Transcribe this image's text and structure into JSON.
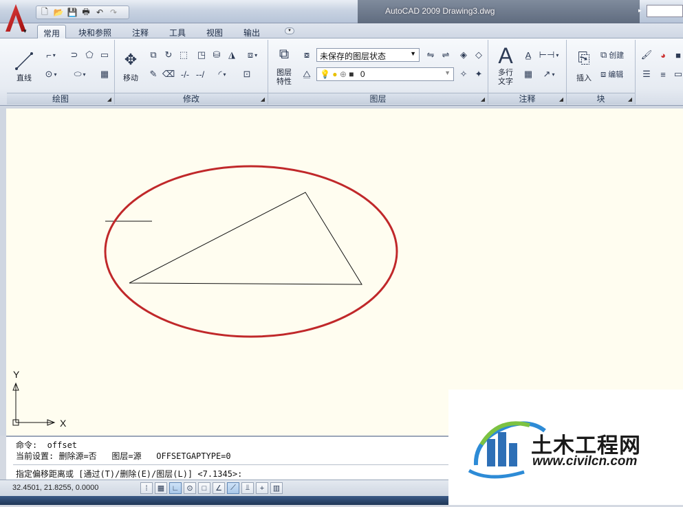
{
  "window": {
    "title": "AutoCAD 2009 Drawing3.dwg"
  },
  "tabs": [
    "常用",
    "块和参照",
    "注释",
    "工具",
    "视图",
    "输出"
  ],
  "ribbon": {
    "panels": {
      "draw": "绘图",
      "modify": "修改",
      "layers": "图层",
      "annotation": "注释",
      "block": "块"
    },
    "labels": {
      "line": "直线",
      "move": "移动",
      "layer_props_1": "图层",
      "layer_props_2": "特性",
      "mtext_1": "多行",
      "mtext_2": "文字",
      "insert": "插入",
      "create": "创建",
      "edit": "编辑"
    },
    "layer_state": "未保存的图层状态",
    "current_layer": "0"
  },
  "ucs": {
    "y_label": "Y",
    "x_label": "X"
  },
  "command": {
    "line1": "命令:  offset",
    "line2": "当前设置: 删除源=否   图层=源   OFFSETGAPTYPE=0",
    "line3": "指定偏移距离或 [通过(T)/删除(E)/图层(L)] <7.1345>:"
  },
  "status": {
    "coords": "32.4501,  21.8255, 0.0000"
  },
  "watermark": {
    "name": "土木工程网",
    "url": "www.civilcn.com"
  },
  "colors": {
    "highlight": "#c0282a",
    "canvas": "#fffdf0"
  }
}
